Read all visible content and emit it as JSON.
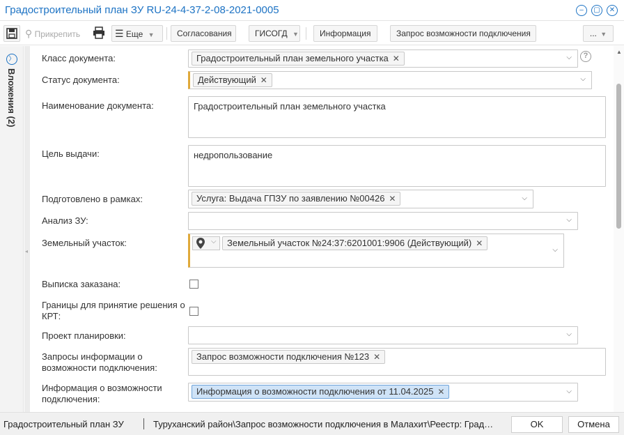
{
  "window": {
    "title": "Градостроительный план ЗУ RU-24-4-37-2-08-2021-0005"
  },
  "toolbar": {
    "attach_label": "Прикрепить",
    "more_label": "Еще",
    "approvals_label": "Согласования",
    "gisogd_label": "ГИСОГД",
    "info_label": "Информация",
    "connection_request_label": "Запрос возможности подключения",
    "overflow_label": "..."
  },
  "sidebar": {
    "attachments_label": "Вложения (2)"
  },
  "form": {
    "doc_class": {
      "label": "Класс документа:",
      "value": "Градостроительный план земельного участка"
    },
    "doc_status": {
      "label": "Статус документа:",
      "value": "Действующий"
    },
    "doc_name": {
      "label": "Наименование документа:",
      "value": "Градостроительный план земельного участка"
    },
    "purpose": {
      "label": "Цель выдачи:",
      "value": "недропользование"
    },
    "prepared_within": {
      "label": "Подготовлено в рамках:",
      "value": "Услуга: Выдача ГПЗУ по заявлению №00426"
    },
    "land_analysis": {
      "label": "Анализ ЗУ:",
      "value": ""
    },
    "land_plot": {
      "label": "Земельный участок:",
      "value": "Земельный участок №24:37:6201001:9906 (Действующий)"
    },
    "extract_ordered": {
      "label": "Выписка заказана:",
      "checked": false
    },
    "krt_bounds": {
      "label": "Границы для принятие решения о КРТ:",
      "checked": false
    },
    "planning_project": {
      "label": "Проект планировки:",
      "value": ""
    },
    "info_requests": {
      "label": "Запросы информации о возможности подключения:",
      "value": "Запрос возможности подключения №123"
    },
    "connection_info": {
      "label": "Информация о возможности подключения:",
      "value": "Информация о возможности подключения от 11.04.2025"
    }
  },
  "statusbar": {
    "doc_type": "Градостроительный план ЗУ",
    "path": "Туруханский район\\Запрос возможности подключения в Малахит\\Реестр: Градостроительный план ЗУ",
    "ok_label": "OK",
    "cancel_label": "Отмена"
  }
}
